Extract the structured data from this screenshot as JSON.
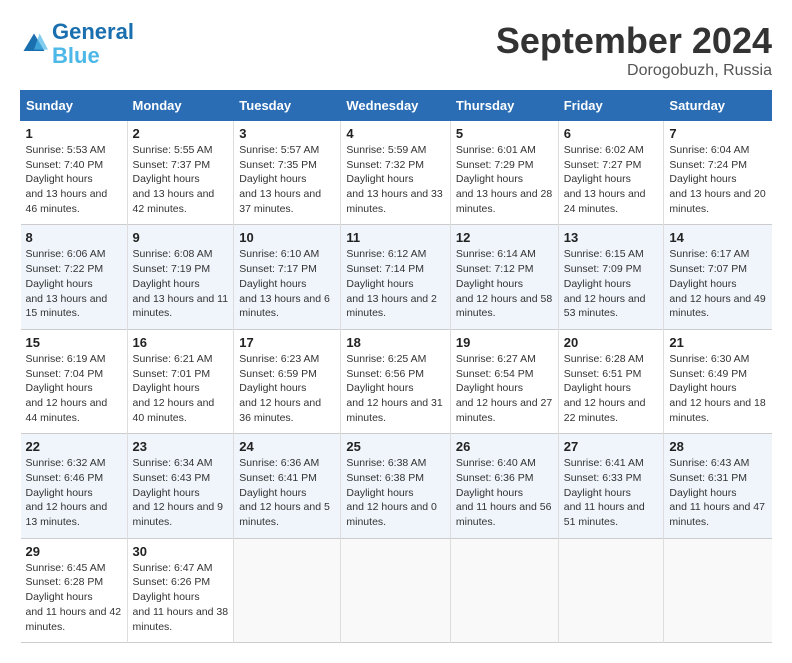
{
  "header": {
    "logo_line1": "General",
    "logo_line2": "Blue",
    "month": "September 2024",
    "location": "Dorogobuzh, Russia"
  },
  "columns": [
    "Sunday",
    "Monday",
    "Tuesday",
    "Wednesday",
    "Thursday",
    "Friday",
    "Saturday"
  ],
  "weeks": [
    [
      {
        "day": "1",
        "sunrise": "5:53 AM",
        "sunset": "7:40 PM",
        "daylight": "13 hours and 46 minutes."
      },
      {
        "day": "2",
        "sunrise": "5:55 AM",
        "sunset": "7:37 PM",
        "daylight": "13 hours and 42 minutes."
      },
      {
        "day": "3",
        "sunrise": "5:57 AM",
        "sunset": "7:35 PM",
        "daylight": "13 hours and 37 minutes."
      },
      {
        "day": "4",
        "sunrise": "5:59 AM",
        "sunset": "7:32 PM",
        "daylight": "13 hours and 33 minutes."
      },
      {
        "day": "5",
        "sunrise": "6:01 AM",
        "sunset": "7:29 PM",
        "daylight": "13 hours and 28 minutes."
      },
      {
        "day": "6",
        "sunrise": "6:02 AM",
        "sunset": "7:27 PM",
        "daylight": "13 hours and 24 minutes."
      },
      {
        "day": "7",
        "sunrise": "6:04 AM",
        "sunset": "7:24 PM",
        "daylight": "13 hours and 20 minutes."
      }
    ],
    [
      {
        "day": "8",
        "sunrise": "6:06 AM",
        "sunset": "7:22 PM",
        "daylight": "13 hours and 15 minutes."
      },
      {
        "day": "9",
        "sunrise": "6:08 AM",
        "sunset": "7:19 PM",
        "daylight": "13 hours and 11 minutes."
      },
      {
        "day": "10",
        "sunrise": "6:10 AM",
        "sunset": "7:17 PM",
        "daylight": "13 hours and 6 minutes."
      },
      {
        "day": "11",
        "sunrise": "6:12 AM",
        "sunset": "7:14 PM",
        "daylight": "13 hours and 2 minutes."
      },
      {
        "day": "12",
        "sunrise": "6:14 AM",
        "sunset": "7:12 PM",
        "daylight": "12 hours and 58 minutes."
      },
      {
        "day": "13",
        "sunrise": "6:15 AM",
        "sunset": "7:09 PM",
        "daylight": "12 hours and 53 minutes."
      },
      {
        "day": "14",
        "sunrise": "6:17 AM",
        "sunset": "7:07 PM",
        "daylight": "12 hours and 49 minutes."
      }
    ],
    [
      {
        "day": "15",
        "sunrise": "6:19 AM",
        "sunset": "7:04 PM",
        "daylight": "12 hours and 44 minutes."
      },
      {
        "day": "16",
        "sunrise": "6:21 AM",
        "sunset": "7:01 PM",
        "daylight": "12 hours and 40 minutes."
      },
      {
        "day": "17",
        "sunrise": "6:23 AM",
        "sunset": "6:59 PM",
        "daylight": "12 hours and 36 minutes."
      },
      {
        "day": "18",
        "sunrise": "6:25 AM",
        "sunset": "6:56 PM",
        "daylight": "12 hours and 31 minutes."
      },
      {
        "day": "19",
        "sunrise": "6:27 AM",
        "sunset": "6:54 PM",
        "daylight": "12 hours and 27 minutes."
      },
      {
        "day": "20",
        "sunrise": "6:28 AM",
        "sunset": "6:51 PM",
        "daylight": "12 hours and 22 minutes."
      },
      {
        "day": "21",
        "sunrise": "6:30 AM",
        "sunset": "6:49 PM",
        "daylight": "12 hours and 18 minutes."
      }
    ],
    [
      {
        "day": "22",
        "sunrise": "6:32 AM",
        "sunset": "6:46 PM",
        "daylight": "12 hours and 13 minutes."
      },
      {
        "day": "23",
        "sunrise": "6:34 AM",
        "sunset": "6:43 PM",
        "daylight": "12 hours and 9 minutes."
      },
      {
        "day": "24",
        "sunrise": "6:36 AM",
        "sunset": "6:41 PM",
        "daylight": "12 hours and 5 minutes."
      },
      {
        "day": "25",
        "sunrise": "6:38 AM",
        "sunset": "6:38 PM",
        "daylight": "12 hours and 0 minutes."
      },
      {
        "day": "26",
        "sunrise": "6:40 AM",
        "sunset": "6:36 PM",
        "daylight": "11 hours and 56 minutes."
      },
      {
        "day": "27",
        "sunrise": "6:41 AM",
        "sunset": "6:33 PM",
        "daylight": "11 hours and 51 minutes."
      },
      {
        "day": "28",
        "sunrise": "6:43 AM",
        "sunset": "6:31 PM",
        "daylight": "11 hours and 47 minutes."
      }
    ],
    [
      {
        "day": "29",
        "sunrise": "6:45 AM",
        "sunset": "6:28 PM",
        "daylight": "11 hours and 42 minutes."
      },
      {
        "day": "30",
        "sunrise": "6:47 AM",
        "sunset": "6:26 PM",
        "daylight": "11 hours and 38 minutes."
      },
      null,
      null,
      null,
      null,
      null
    ]
  ]
}
